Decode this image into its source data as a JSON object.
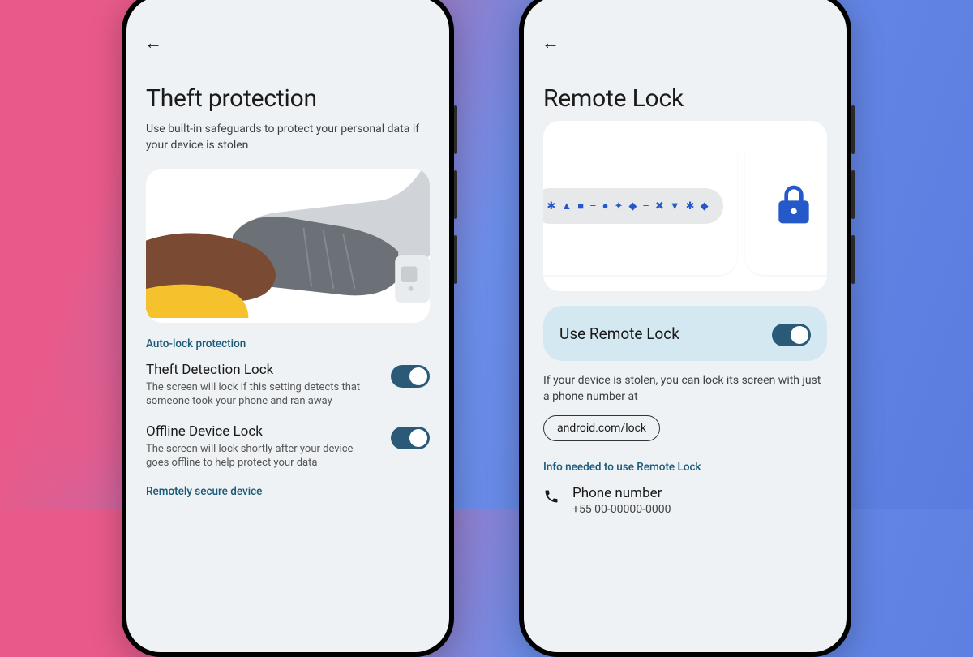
{
  "phone1": {
    "title": "Theft protection",
    "subtitle": "Use built-in safeguards to protect your personal data if your device is stolen",
    "section_label": "Auto-lock protection",
    "setting1": {
      "title": "Theft Detection Lock",
      "subtitle": "The screen will lock if this setting detects that someone took your phone and ran away",
      "enabled": true
    },
    "setting2": {
      "title": "Offline Device Lock",
      "subtitle": "The screen will lock shortly after your device goes offline to help protect your data",
      "enabled": true
    },
    "link": "Remotely secure device"
  },
  "phone2": {
    "title": "Remote Lock",
    "toggle_label": "Use Remote Lock",
    "toggle_enabled": true,
    "description": "If your device is stolen, you can lock its screen with just a phone number at",
    "chip": "android.com/lock",
    "section_label": "Info needed to use Remote Lock",
    "row1": {
      "title": "Phone number",
      "value": "+55 00-00000-0000"
    }
  },
  "colors": {
    "accent": "#2a5a78",
    "link": "#1a5a7a",
    "blue": "#2558c8"
  }
}
